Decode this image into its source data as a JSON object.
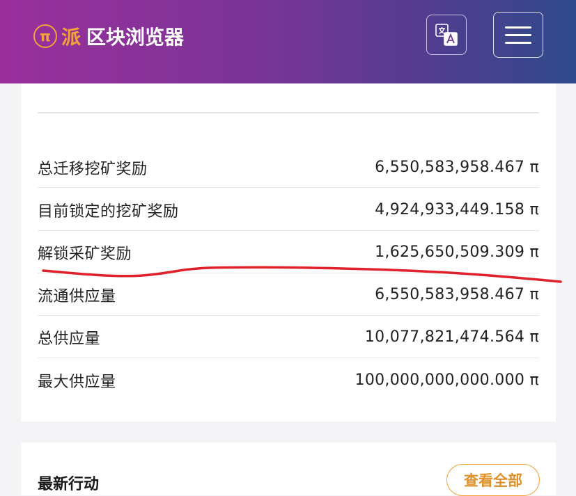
{
  "header": {
    "logo_glyph": "π",
    "logo_pi": "派",
    "logo_title": "区块浏览器",
    "accent_color": "#f2a33a"
  },
  "stats": {
    "rows": [
      {
        "label": "总迁移挖矿奖励",
        "value": "6,550,583,958.467 π"
      },
      {
        "label": "目前锁定的挖矿奖励",
        "value": "4,924,933,449.158 π"
      },
      {
        "label": "解锁采矿奖励",
        "value": "1,625,650,509.309 π"
      },
      {
        "label": "流通供应量",
        "value": "6,550,583,958.467 π"
      },
      {
        "label": "总供应量",
        "value": "10,077,821,474.564 π"
      },
      {
        "label": "最大供应量",
        "value": "100,000,000,000.000 π"
      }
    ]
  },
  "latest": {
    "title": "最新行动",
    "view_all": "查看全部"
  },
  "annotation": {
    "color": "#e0202a"
  }
}
